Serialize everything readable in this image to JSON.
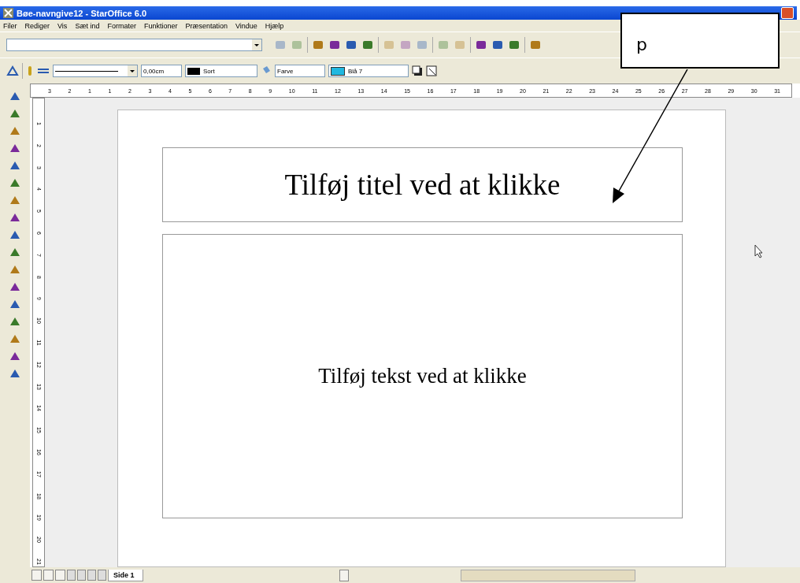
{
  "window": {
    "title": "Bøe-navngive12 - StarOffice 6.0"
  },
  "menu": [
    "Filer",
    "Rediger",
    "Vis",
    "Sæt ind",
    "Formater",
    "Funktioner",
    "Præsentation",
    "Vindue",
    "Hjælp"
  ],
  "line_toolbar": {
    "line_width": "0,00cm",
    "line_color": "Sort",
    "area_style": "Farve",
    "area_color": "Blå 7"
  },
  "ruler": {
    "horizontal": [
      "3",
      "2",
      "1",
      "1",
      "2",
      "3",
      "4",
      "5",
      "6",
      "7",
      "8",
      "9",
      "10",
      "11",
      "12",
      "13",
      "14",
      "15",
      "16",
      "17",
      "18",
      "19",
      "20",
      "21",
      "22",
      "23",
      "24",
      "25",
      "26",
      "27",
      "28",
      "29",
      "30",
      "31"
    ],
    "vertical": [
      "1",
      "2",
      "3",
      "4",
      "5",
      "6",
      "7",
      "8",
      "9",
      "10",
      "11",
      "12",
      "13",
      "14",
      "15",
      "16",
      "17",
      "18",
      "19",
      "20",
      "21"
    ]
  },
  "slide": {
    "title_placeholder": "Tilføj titel ved at klikke",
    "text_placeholder": "Tilføj tekst ved at klikke"
  },
  "tabs": [
    {
      "label": "Side 1",
      "selected": true
    }
  ],
  "callout": {
    "text": "p"
  }
}
